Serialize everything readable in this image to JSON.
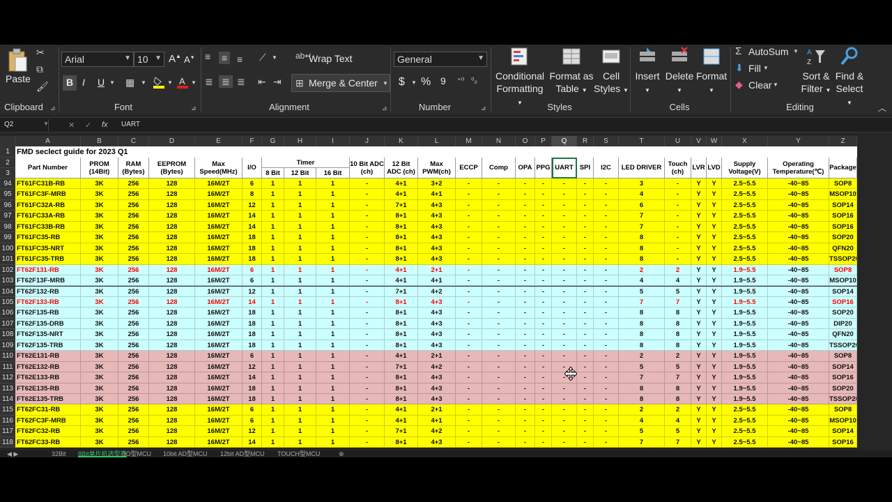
{
  "ribbon": {
    "clipboard": {
      "paste": "Paste",
      "label": "Clipboard"
    },
    "font": {
      "name": "Arial",
      "size": "10",
      "label": "Font",
      "bold": "B",
      "italic": "I",
      "underline": "U"
    },
    "alignment": {
      "wrap_text": "Wrap Text",
      "merge_center": "Merge & Center",
      "label": "Alignment"
    },
    "number": {
      "format": "General",
      "currency": "$",
      "percent": "%",
      "comma": "9",
      "label": "Number"
    },
    "styles": {
      "conditional_1": "Conditional",
      "conditional_2": "Formatting",
      "format_as_1": "Format as",
      "format_as_2": "Table",
      "cell_styles_1": "Cell",
      "cell_styles_2": "Styles",
      "label": "Styles"
    },
    "cells": {
      "insert": "Insert",
      "delete": "Delete",
      "format": "Format",
      "label": "Cells"
    },
    "editing": {
      "autosum": "AutoSum",
      "fill": "Fill",
      "clear": "Clear",
      "sort_1": "Sort &",
      "sort_2": "Filter",
      "find_1": "Find &",
      "find_2": "Select",
      "label": "Editing"
    }
  },
  "formula_bar": {
    "name_box": "Q2",
    "fx": "fx",
    "formula": "UART"
  },
  "columns": [
    {
      "id": "A",
      "w": 94
    },
    {
      "id": "B",
      "w": 54
    },
    {
      "id": "C",
      "w": 44
    },
    {
      "id": "D",
      "w": 66
    },
    {
      "id": "E",
      "w": 68
    },
    {
      "id": "F",
      "w": 28
    },
    {
      "id": "G",
      "w": 32
    },
    {
      "id": "H",
      "w": 46
    },
    {
      "id": "I",
      "w": 48
    },
    {
      "id": "J",
      "w": 50
    },
    {
      "id": "K",
      "w": 48
    },
    {
      "id": "L",
      "w": 54
    },
    {
      "id": "M",
      "w": 38
    },
    {
      "id": "N",
      "w": 48
    },
    {
      "id": "O",
      "w": 28
    },
    {
      "id": "P",
      "w": 24
    },
    {
      "id": "Q",
      "w": 36
    },
    {
      "id": "R",
      "w": 24
    },
    {
      "id": "S",
      "w": 36
    },
    {
      "id": "T",
      "w": 66
    },
    {
      "id": "U",
      "w": 38
    },
    {
      "id": "V",
      "w": 22
    },
    {
      "id": "W",
      "w": 22
    },
    {
      "id": "X",
      "w": 66
    },
    {
      "id": "Y",
      "w": 88
    },
    {
      "id": "Z",
      "w": 40
    }
  ],
  "selected_column": "Q",
  "sheet_title": "FMD seclect guide for 2023 Q1",
  "headers": {
    "row2": [
      "Part Number",
      "PROM (14Bit)",
      "RAM (Bytes)",
      "EEPROM (Bytes)",
      "Max Speed(MHz)",
      "I/O",
      "Timer",
      "",
      "",
      "10 Bit ADC (ch)",
      "12 Bit ADC (ch)",
      "Max PWM(ch)",
      "ECCP",
      "Comp",
      "OPA",
      "PPG",
      "UART",
      "SPI",
      "I2C",
      "LED DRIVER",
      "Touch (ch)",
      "LVR",
      "LVD",
      "Supply Voltage(V)",
      "Operating Temperature(℃)",
      "Package"
    ],
    "timer_sub": [
      "8 Bit",
      "12 Bit",
      "16 Bit"
    ]
  },
  "colors": {
    "yellow": "#ffff00",
    "cyan": "#ccffff",
    "pink": "#e6b8b7",
    "red_text": "#ff0000"
  },
  "rows": [
    {
      "n": "94",
      "bg": "yellow",
      "cells": [
        "FT61FC31B-RB",
        "3K",
        "256",
        "128",
        "16M/2T",
        "6",
        "1",
        "1",
        "1",
        "-",
        "4+1",
        "3+2",
        "-",
        "-",
        "-",
        "-",
        "-",
        "-",
        "-",
        "3",
        "-",
        "Y",
        "Y",
        "2.5~5.5",
        "-40~85",
        "SOP8"
      ]
    },
    {
      "n": "95",
      "bg": "yellow",
      "cells": [
        "FT61FC3F-MRB",
        "3K",
        "256",
        "128",
        "16M/2T",
        "8",
        "1",
        "1",
        "1",
        "-",
        "4+1",
        "4+1",
        "-",
        "-",
        "-",
        "-",
        "-",
        "-",
        "-",
        "4",
        "-",
        "Y",
        "Y",
        "2.5~5.5",
        "-40~85",
        "MSOP10"
      ]
    },
    {
      "n": "96",
      "bg": "yellow",
      "cells": [
        "FT61FC32A-RB",
        "3K",
        "256",
        "128",
        "16M/2T",
        "12",
        "1",
        "1",
        "1",
        "-",
        "7+1",
        "4+3",
        "-",
        "-",
        "-",
        "-",
        "-",
        "-",
        "-",
        "6",
        "-",
        "Y",
        "Y",
        "2.5~5.5",
        "-40~85",
        "SOP14"
      ]
    },
    {
      "n": "97",
      "bg": "yellow",
      "cells": [
        "FT61FC33A-RB",
        "3K",
        "256",
        "128",
        "16M/2T",
        "14",
        "1",
        "1",
        "1",
        "-",
        "8+1",
        "4+3",
        "-",
        "-",
        "-",
        "-",
        "-",
        "-",
        "-",
        "7",
        "-",
        "Y",
        "Y",
        "2.5~5.5",
        "-40~85",
        "SOP16"
      ]
    },
    {
      "n": "98",
      "bg": "yellow",
      "cells": [
        "FT61FC33B-RB",
        "3K",
        "256",
        "128",
        "16M/2T",
        "14",
        "1",
        "1",
        "1",
        "-",
        "8+1",
        "4+3",
        "-",
        "-",
        "-",
        "-",
        "-",
        "-",
        "-",
        "7",
        "-",
        "Y",
        "Y",
        "2.5~5.5",
        "-40~85",
        "SOP16"
      ]
    },
    {
      "n": "99",
      "bg": "yellow",
      "cells": [
        "FT61FC35-RB",
        "3K",
        "256",
        "128",
        "16M/2T",
        "18",
        "1",
        "1",
        "1",
        "-",
        "8+1",
        "4+3",
        "-",
        "-",
        "-",
        "-",
        "-",
        "-",
        "-",
        "8",
        "-",
        "Y",
        "Y",
        "2.5~5.5",
        "-40~85",
        "SOP20"
      ]
    },
    {
      "n": "100",
      "bg": "yellow",
      "cells": [
        "FT61FC35-NRT",
        "3K",
        "256",
        "128",
        "16M/2T",
        "18",
        "1",
        "1",
        "1",
        "-",
        "8+1",
        "4+3",
        "-",
        "-",
        "-",
        "-",
        "-",
        "-",
        "-",
        "8",
        "-",
        "Y",
        "Y",
        "2.5~5.5",
        "-40~85",
        "QFN20"
      ]
    },
    {
      "n": "101",
      "bg": "yellow",
      "cells": [
        "FT61FC35-TRB",
        "3K",
        "256",
        "128",
        "16M/2T",
        "18",
        "1",
        "1",
        "1",
        "-",
        "8+1",
        "4+3",
        "-",
        "-",
        "-",
        "-",
        "-",
        "-",
        "-",
        "8",
        "-",
        "Y",
        "Y",
        "2.5~5.5",
        "-40~85",
        "TSSOP20"
      ]
    },
    {
      "n": "102",
      "bg": "cyan",
      "red": true,
      "cells": [
        "FT62F131-RB",
        "3K",
        "256",
        "128",
        "16M/2T",
        "6",
        "1",
        "1",
        "1",
        "-",
        "4+1",
        "2+1",
        "-",
        "-",
        "-",
        "-",
        "-",
        "-",
        "-",
        "2",
        "2",
        "Y",
        "Y",
        "1.9~5.5",
        "-40~85",
        "SOP8"
      ]
    },
    {
      "n": "103",
      "bg": "cyan",
      "cells": [
        "FT62F13F-MRB",
        "3K",
        "256",
        "128",
        "16M/2T",
        "6",
        "1",
        "1",
        "1",
        "-",
        "4+1",
        "4+1",
        "-",
        "-",
        "-",
        "-",
        "-",
        "-",
        "-",
        "4",
        "4",
        "Y",
        "Y",
        "1.9~5.5",
        "-40~85",
        "MSOP10"
      ]
    },
    {
      "n": "104",
      "bg": "cyan",
      "cells": [
        "FT62F132-RB",
        "3K",
        "256",
        "128",
        "16M/2T",
        "12",
        "1",
        "1",
        "1",
        "-",
        "7+1",
        "4+2",
        "-",
        "-",
        "-",
        "-",
        "-",
        "-",
        "-",
        "5",
        "5",
        "Y",
        "Y",
        "1.9~5.5",
        "-40~85",
        "SOP14"
      ]
    },
    {
      "n": "105",
      "bg": "cyan",
      "red": true,
      "cells": [
        "FT62F133-RB",
        "3K",
        "256",
        "128",
        "16M/2T",
        "14",
        "1",
        "1",
        "1",
        "-",
        "8+1",
        "4+3",
        "-",
        "-",
        "-",
        "-",
        "-",
        "-",
        "-",
        "7",
        "7",
        "Y",
        "Y",
        "1.9~5.5",
        "-40~85",
        "SOP16"
      ]
    },
    {
      "n": "106",
      "bg": "cyan",
      "cells": [
        "FT62F135-RB",
        "3K",
        "256",
        "128",
        "16M/2T",
        "18",
        "1",
        "1",
        "1",
        "-",
        "8+1",
        "4+3",
        "-",
        "-",
        "-",
        "-",
        "-",
        "-",
        "-",
        "8",
        "8",
        "Y",
        "Y",
        "1.9~5.5",
        "-40~85",
        "SOP20"
      ]
    },
    {
      "n": "107",
      "bg": "cyan",
      "cells": [
        "FT62F135-DRB",
        "3K",
        "256",
        "128",
        "16M/2T",
        "18",
        "1",
        "1",
        "1",
        "-",
        "8+1",
        "4+3",
        "-",
        "-",
        "-",
        "-",
        "-",
        "-",
        "-",
        "8",
        "8",
        "Y",
        "Y",
        "1.9~5.5",
        "-40~85",
        "DIP20"
      ]
    },
    {
      "n": "108",
      "bg": "cyan",
      "cells": [
        "FT62F135-NRT",
        "3K",
        "256",
        "128",
        "16M/2T",
        "18",
        "1",
        "1",
        "1",
        "-",
        "8+1",
        "4+3",
        "-",
        "-",
        "-",
        "-",
        "-",
        "-",
        "-",
        "8",
        "8",
        "Y",
        "Y",
        "1.9~5.5",
        "-40~85",
        "QFN20"
      ]
    },
    {
      "n": "109",
      "bg": "cyan",
      "cells": [
        "FT62F135-TRB",
        "3K",
        "256",
        "128",
        "16M/2T",
        "18",
        "1",
        "1",
        "1",
        "-",
        "8+1",
        "4+3",
        "-",
        "-",
        "-",
        "-",
        "-",
        "-",
        "-",
        "8",
        "8",
        "Y",
        "Y",
        "1.9~5.5",
        "-40~85",
        "TSSOP20"
      ]
    },
    {
      "n": "110",
      "bg": "pink",
      "cells": [
        "FT62E131-RB",
        "3K",
        "256",
        "128",
        "16M/2T",
        "6",
        "1",
        "1",
        "1",
        "-",
        "4+1",
        "2+1",
        "-",
        "-",
        "-",
        "-",
        "-",
        "-",
        "-",
        "2",
        "2",
        "Y",
        "Y",
        "1.9~5.5",
        "-40~85",
        "SOP8"
      ]
    },
    {
      "n": "111",
      "bg": "pink",
      "cells": [
        "FT62E132-RB",
        "3K",
        "256",
        "128",
        "16M/2T",
        "12",
        "1",
        "1",
        "1",
        "-",
        "7+1",
        "4+2",
        "-",
        "-",
        "-",
        "-",
        "-",
        "-",
        "-",
        "5",
        "5",
        "Y",
        "Y",
        "1.9~5.5",
        "-40~85",
        "SOP14"
      ]
    },
    {
      "n": "112",
      "bg": "pink",
      "cells": [
        "FT62E133-RB",
        "3K",
        "256",
        "128",
        "16M/2T",
        "14",
        "1",
        "1",
        "1",
        "-",
        "8+1",
        "4+3",
        "-",
        "-",
        "-",
        "-",
        "-",
        "-",
        "-",
        "7",
        "7",
        "Y",
        "Y",
        "1.9~5.5",
        "-40~85",
        "SOP16"
      ]
    },
    {
      "n": "113",
      "bg": "pink",
      "cells": [
        "FT62E135-RB",
        "3K",
        "256",
        "128",
        "16M/2T",
        "18",
        "1",
        "1",
        "1",
        "-",
        "8+1",
        "4+3",
        "-",
        "-",
        "-",
        "-",
        "-",
        "-",
        "-",
        "8",
        "8",
        "Y",
        "Y",
        "1.9~5.5",
        "-40~85",
        "SOP20"
      ]
    },
    {
      "n": "114",
      "bg": "pink",
      "cells": [
        "FT62E135-TRB",
        "3K",
        "256",
        "128",
        "16M/2T",
        "18",
        "1",
        "1",
        "1",
        "-",
        "8+1",
        "4+3",
        "-",
        "-",
        "-",
        "-",
        "-",
        "-",
        "-",
        "8",
        "8",
        "Y",
        "Y",
        "1.9~5.5",
        "-40~85",
        "TSSOP20"
      ]
    },
    {
      "n": "115",
      "bg": "yellow",
      "cells": [
        "FT62FC31-RB",
        "3K",
        "256",
        "128",
        "16M/2T",
        "6",
        "1",
        "1",
        "1",
        "-",
        "4+1",
        "2+1",
        "-",
        "-",
        "-",
        "-",
        "-",
        "-",
        "-",
        "2",
        "2",
        "Y",
        "Y",
        "2.5~5.5",
        "-40~85",
        "SOP8"
      ]
    },
    {
      "n": "116",
      "bg": "yellow",
      "cells": [
        "FT62FC3F-MRB",
        "3K",
        "256",
        "128",
        "16M/2T",
        "6",
        "1",
        "1",
        "1",
        "-",
        "4+1",
        "4+1",
        "-",
        "-",
        "-",
        "-",
        "-",
        "-",
        "-",
        "4",
        "4",
        "Y",
        "Y",
        "2.5~5.5",
        "-40~85",
        "MSOP10"
      ]
    },
    {
      "n": "117",
      "bg": "yellow",
      "cells": [
        "FT62FC32-RB",
        "3K",
        "256",
        "128",
        "16M/2T",
        "12",
        "1",
        "1",
        "1",
        "-",
        "7+1",
        "4+2",
        "-",
        "-",
        "-",
        "-",
        "-",
        "-",
        "-",
        "5",
        "5",
        "Y",
        "Y",
        "2.5~5.5",
        "-40~85",
        "SOP14"
      ]
    },
    {
      "n": "118",
      "bg": "yellow",
      "cells": [
        "FT62FC33-RB",
        "3K",
        "256",
        "128",
        "16M/2T",
        "14",
        "1",
        "1",
        "1",
        "-",
        "8+1",
        "4+3",
        "-",
        "-",
        "-",
        "-",
        "-",
        "-",
        "-",
        "7",
        "7",
        "Y",
        "Y",
        "2.5~5.5",
        "-40~85",
        "SOP16"
      ]
    }
  ],
  "sheet_tabs": [
    "32Bit",
    "8Bit单片机选型表",
    "IO型MCU",
    "10bit AD型MCU",
    "12bit AD型MCU",
    "TOUCH型MCU"
  ],
  "active_tab": 1
}
